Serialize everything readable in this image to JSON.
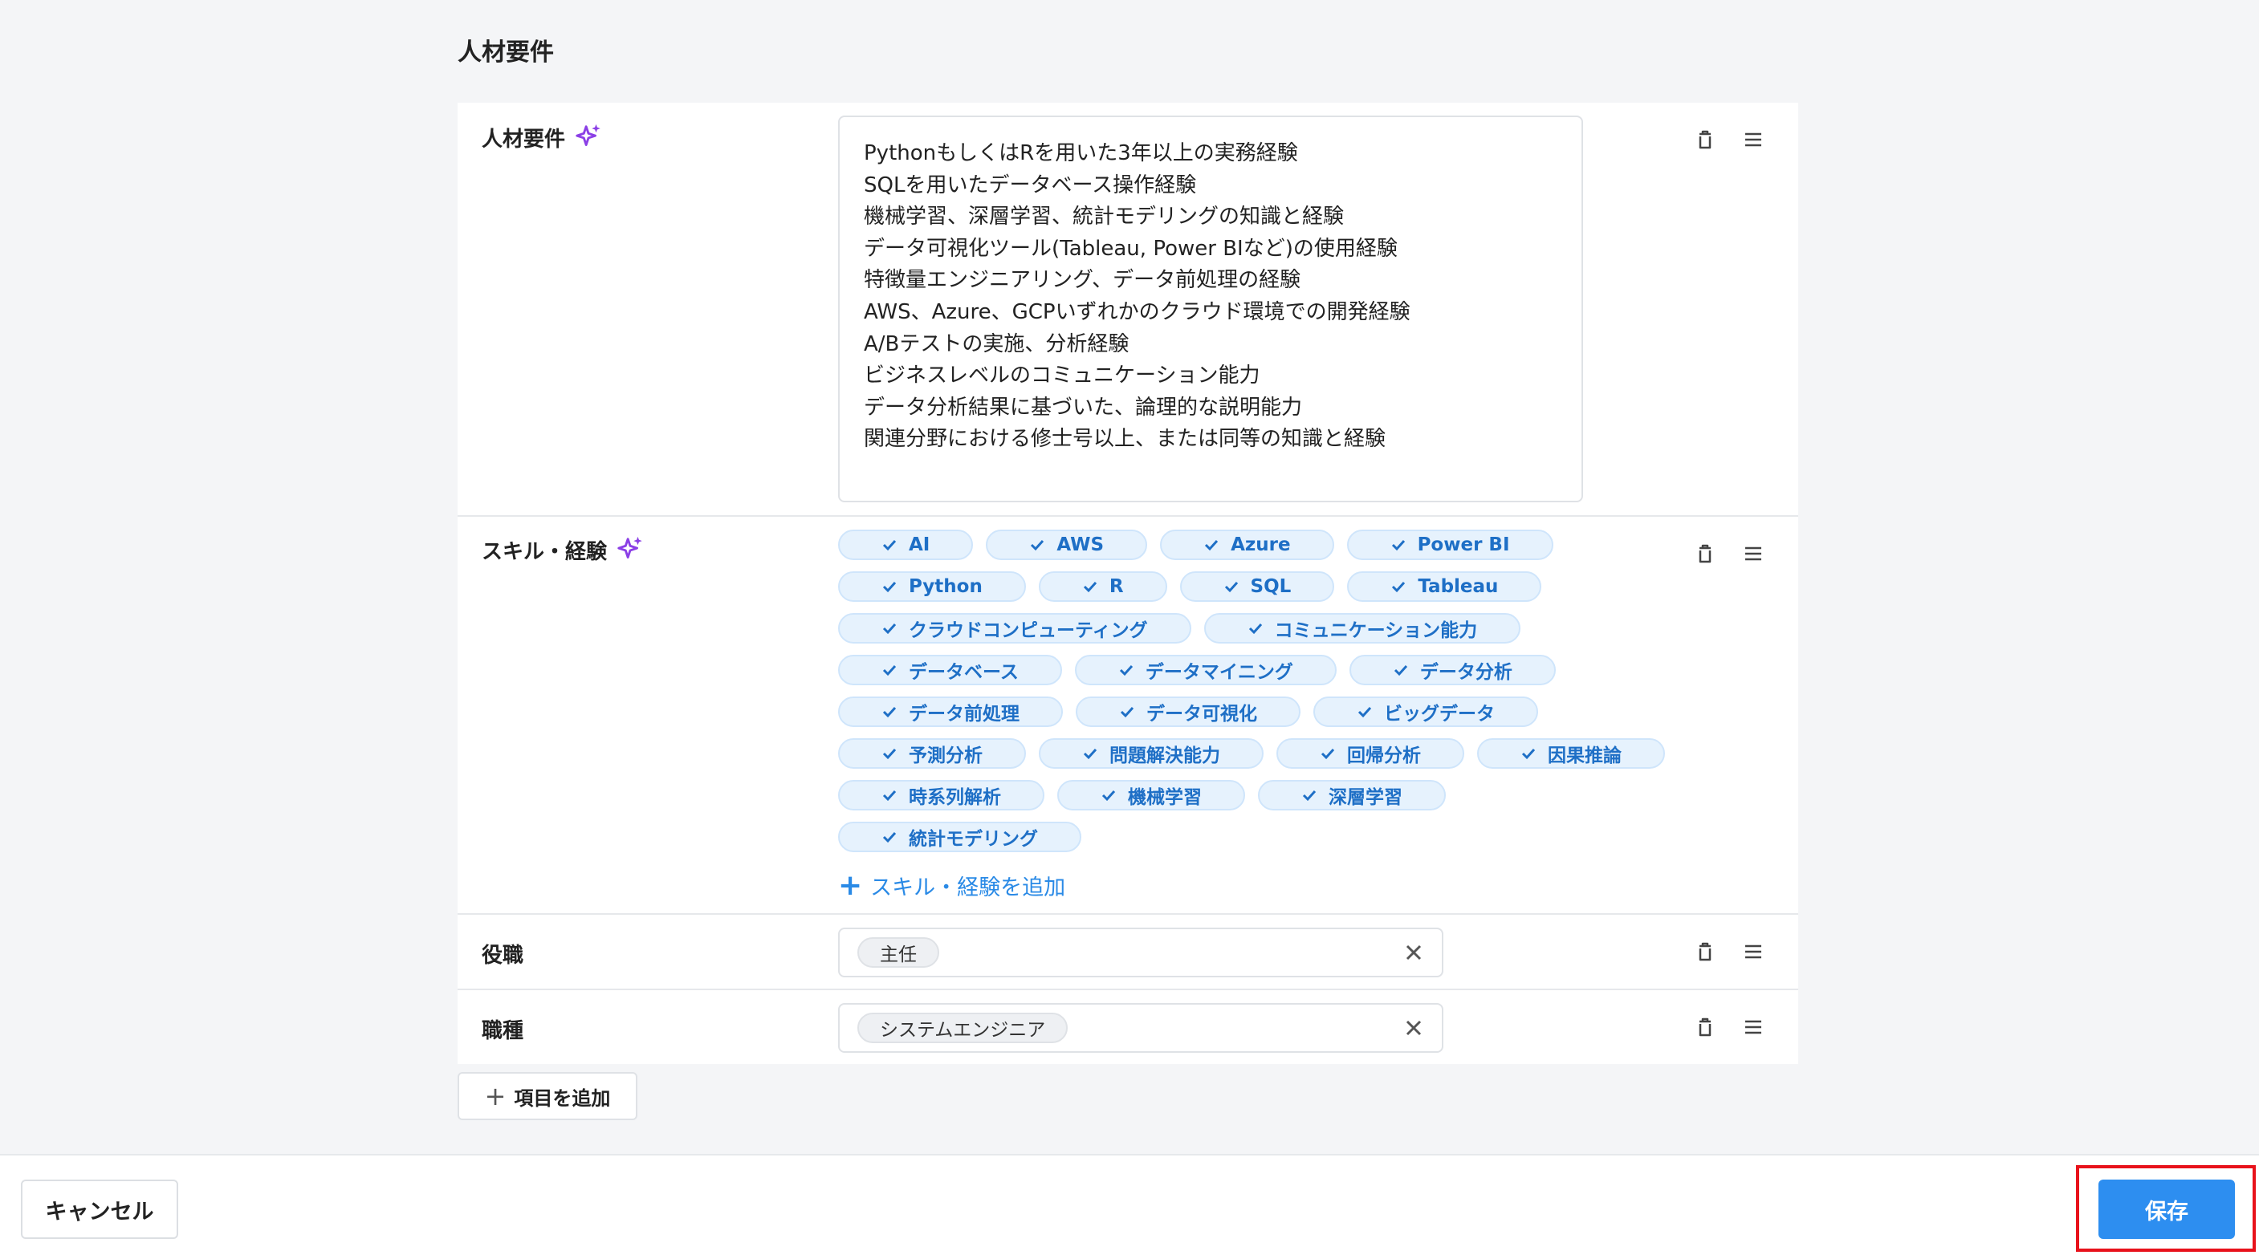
{
  "section": {
    "title": "人材要件"
  },
  "rows": {
    "requirements": {
      "label": "人材要件",
      "lines": [
        "PythonもしくはRを用いた3年以上の実務経験",
        "SQLを用いたデータベース操作経験",
        "機械学習、深層学習、統計モデリングの知識と経験",
        "データ可視化ツール(Tableau, Power BIなど)の使用経験",
        "特徴量エンジニアリング、データ前処理の経験",
        "AWS、Azure、GCPいずれかのクラウド環境での開発経験",
        "A/Bテストの実施、分析経験",
        "ビジネスレベルのコミュニケーション能力",
        "データ分析結果に基づいた、論理的な説明能力",
        "関連分野における修士号以上、または同等の知識と経験"
      ]
    },
    "skills": {
      "label": "スキル・経験",
      "tags": [
        "AI",
        "AWS",
        "Azure",
        "Power BI",
        "Python",
        "R",
        "SQL",
        "Tableau",
        "クラウドコンピューティング",
        "コミュニケーション能力",
        "データベース",
        "データマイニング",
        "データ分析",
        "データ前処理",
        "データ可視化",
        "ビッグデータ",
        "予測分析",
        "問題解決能力",
        "回帰分析",
        "因果推論",
        "時系列解析",
        "機械学習",
        "深層学習",
        "統計モデリング"
      ],
      "add_label": "スキル・経験を追加"
    },
    "position": {
      "label": "役職",
      "value": "主任"
    },
    "job_type": {
      "label": "職種",
      "value": "システムエンジニア"
    }
  },
  "add_item_label": "項目を追加",
  "footer": {
    "cancel_label": "キャンセル",
    "save_label": "保存"
  },
  "colors": {
    "accent": "#2d8ef0",
    "tag_text": "#1e6fc6",
    "tag_bg": "#e6f2fd",
    "sparkle": "#8b3fe6",
    "highlight": "#e8121b"
  },
  "icons": {
    "sparkle": "sparkle-icon",
    "trash": "trash-icon",
    "drag": "drag-handle-icon",
    "check": "check-icon",
    "clear": "close-icon",
    "plus": "plus-icon"
  }
}
